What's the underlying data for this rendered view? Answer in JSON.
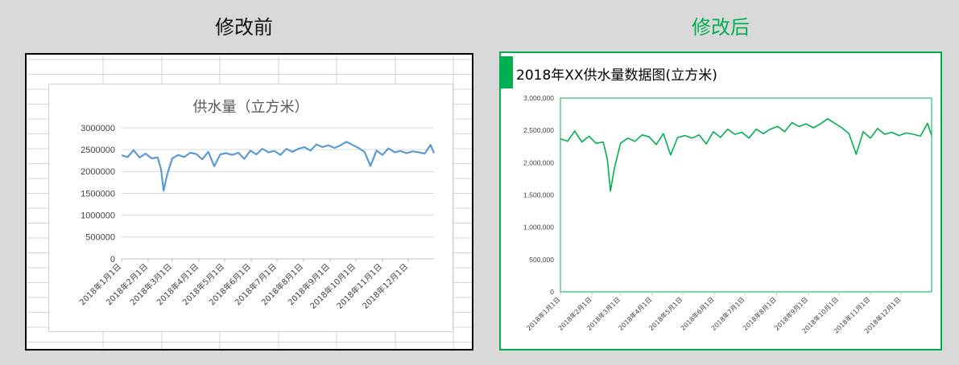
{
  "headings": {
    "before": "修改前",
    "after": "修改后"
  },
  "colors": {
    "before_line": "#5b9bd5",
    "after_line": "#00b050",
    "accent": "#00b050"
  },
  "chart_data": [
    {
      "type": "line",
      "title": "供水量（立方米）",
      "xlabel": "",
      "ylabel": "",
      "ylim": [
        0,
        3000000
      ],
      "y_ticks": [
        "3000000",
        "2500000",
        "2000000",
        "1500000",
        "1000000",
        "500000",
        "0"
      ],
      "x_tick_labels": [
        "2018年1月1日",
        "2018年2月1日",
        "2018年3月1日",
        "2018年4月1日",
        "2018年5月1日",
        "2018年6月1日",
        "2018年7月1日",
        "2018年8月1日",
        "2018年9月1日",
        "2018年10月1日",
        "2018年11月1日",
        "2018年12月1日"
      ],
      "grid": true,
      "series": [
        {
          "x": [
            "2018-01-01",
            "2018-01-08",
            "2018-01-15",
            "2018-01-22",
            "2018-01-29",
            "2018-02-05",
            "2018-02-12",
            "2018-02-16",
            "2018-02-19",
            "2018-02-23",
            "2018-03-01",
            "2018-03-08",
            "2018-03-15",
            "2018-03-22",
            "2018-03-29",
            "2018-04-05",
            "2018-04-12",
            "2018-04-19",
            "2018-04-26",
            "2018-05-03",
            "2018-05-10",
            "2018-05-17",
            "2018-05-24",
            "2018-05-31",
            "2018-06-07",
            "2018-06-14",
            "2018-06-21",
            "2018-06-28",
            "2018-07-05",
            "2018-07-12",
            "2018-07-19",
            "2018-07-26",
            "2018-08-02",
            "2018-08-09",
            "2018-08-16",
            "2018-08-23",
            "2018-08-30",
            "2018-09-06",
            "2018-09-13",
            "2018-09-20",
            "2018-09-27",
            "2018-10-04",
            "2018-10-11",
            "2018-10-18",
            "2018-10-25",
            "2018-11-01",
            "2018-11-08",
            "2018-11-15",
            "2018-11-22",
            "2018-11-29",
            "2018-12-06",
            "2018-12-13",
            "2018-12-20",
            "2018-12-27",
            "2018-12-31"
          ],
          "values": [
            2370000,
            2330000,
            2490000,
            2320000,
            2410000,
            2300000,
            2320000,
            2050000,
            1560000,
            1920000,
            2300000,
            2380000,
            2330000,
            2430000,
            2400000,
            2280000,
            2450000,
            2120000,
            2390000,
            2420000,
            2380000,
            2430000,
            2290000,
            2480000,
            2390000,
            2520000,
            2440000,
            2470000,
            2380000,
            2520000,
            2450000,
            2520000,
            2560000,
            2480000,
            2620000,
            2560000,
            2600000,
            2540000,
            2600000,
            2680000,
            2610000,
            2540000,
            2450000,
            2130000,
            2480000,
            2380000,
            2530000,
            2440000,
            2470000,
            2420000,
            2460000,
            2440000,
            2410000,
            2610000,
            2420000
          ]
        }
      ]
    },
    {
      "type": "line",
      "title": "2018年XX供水量数据图(立方米)",
      "xlabel": "",
      "ylabel": "",
      "ylim": [
        0,
        3000000
      ],
      "y_ticks": [
        "3,000,000",
        "2,500,000",
        "2,000,000",
        "1,500,000",
        "1,000,000",
        "500,000",
        "0"
      ],
      "x_tick_labels": [
        "2018年1月1日",
        "2018年2月1日",
        "2018年3月1日",
        "2018年4月1日",
        "2018年5月1日",
        "2018年6月1日",
        "2018年7月1日",
        "2018年8月1日",
        "2018年9月1日",
        "2018年10月1日",
        "2018年11月1日",
        "2018年12月1日"
      ],
      "grid": false,
      "series": [
        {
          "x": [
            "2018-01-01",
            "2018-01-08",
            "2018-01-15",
            "2018-01-22",
            "2018-01-29",
            "2018-02-05",
            "2018-02-12",
            "2018-02-16",
            "2018-02-19",
            "2018-02-23",
            "2018-03-01",
            "2018-03-08",
            "2018-03-15",
            "2018-03-22",
            "2018-03-29",
            "2018-04-05",
            "2018-04-12",
            "2018-04-19",
            "2018-04-26",
            "2018-05-03",
            "2018-05-10",
            "2018-05-17",
            "2018-05-24",
            "2018-05-31",
            "2018-06-07",
            "2018-06-14",
            "2018-06-21",
            "2018-06-28",
            "2018-07-05",
            "2018-07-12",
            "2018-07-19",
            "2018-07-26",
            "2018-08-02",
            "2018-08-09",
            "2018-08-16",
            "2018-08-23",
            "2018-08-30",
            "2018-09-06",
            "2018-09-13",
            "2018-09-20",
            "2018-09-27",
            "2018-10-04",
            "2018-10-11",
            "2018-10-18",
            "2018-10-25",
            "2018-11-01",
            "2018-11-08",
            "2018-11-15",
            "2018-11-22",
            "2018-11-29",
            "2018-12-06",
            "2018-12-13",
            "2018-12-20",
            "2018-12-27",
            "2018-12-31"
          ],
          "values": [
            2370000,
            2330000,
            2490000,
            2320000,
            2410000,
            2300000,
            2320000,
            2050000,
            1560000,
            1920000,
            2300000,
            2380000,
            2330000,
            2430000,
            2400000,
            2280000,
            2450000,
            2120000,
            2390000,
            2420000,
            2380000,
            2430000,
            2290000,
            2480000,
            2390000,
            2520000,
            2440000,
            2470000,
            2380000,
            2520000,
            2450000,
            2520000,
            2560000,
            2480000,
            2620000,
            2560000,
            2600000,
            2540000,
            2600000,
            2680000,
            2610000,
            2540000,
            2450000,
            2130000,
            2480000,
            2380000,
            2530000,
            2440000,
            2470000,
            2420000,
            2460000,
            2440000,
            2410000,
            2610000,
            2420000
          ]
        }
      ]
    }
  ]
}
